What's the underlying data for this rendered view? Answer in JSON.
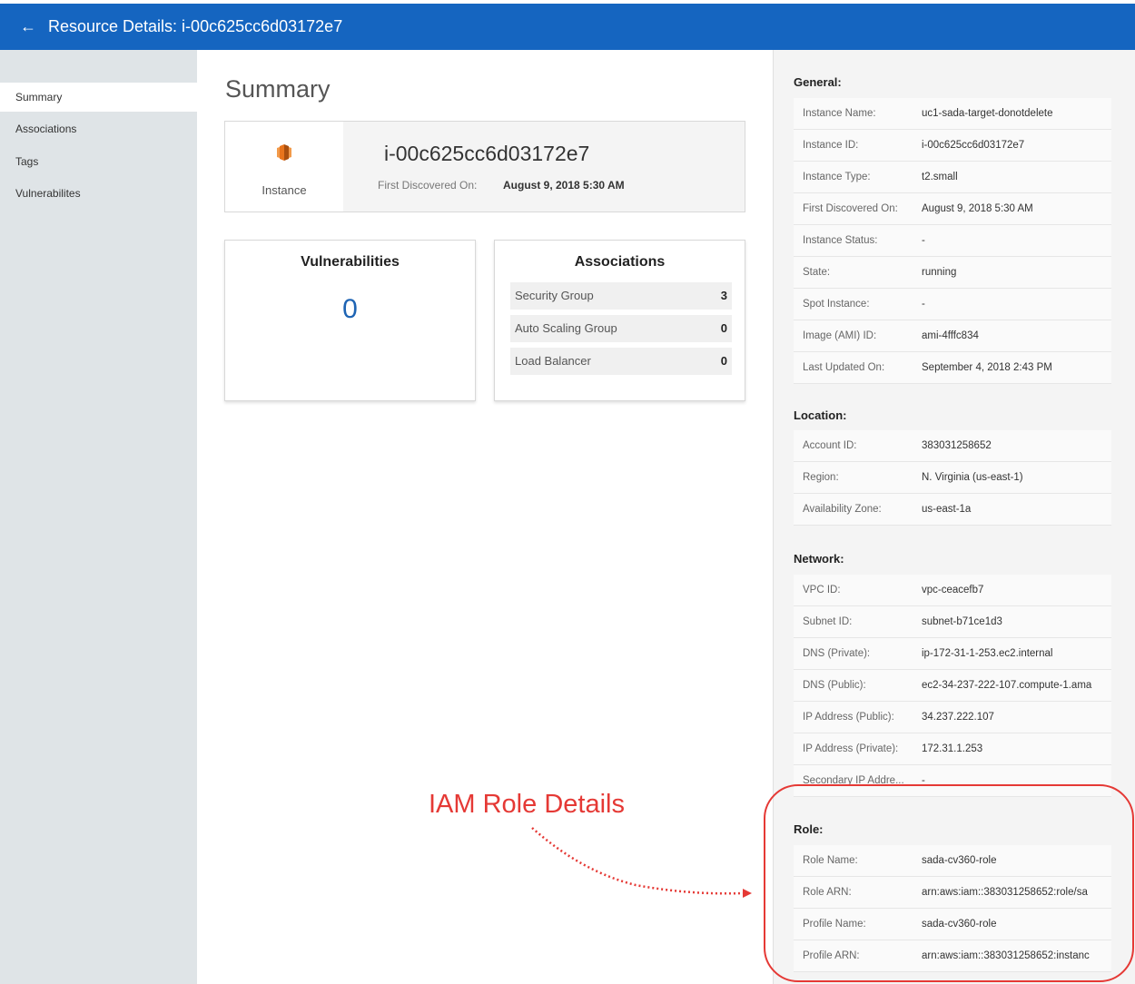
{
  "header": {
    "back_icon": "←",
    "title": "Resource Details: i-00c625cc6d03172e7"
  },
  "sidebar": {
    "items": [
      {
        "label": "Summary"
      },
      {
        "label": "Associations"
      },
      {
        "label": "Tags"
      },
      {
        "label": "Vulnerabilites"
      }
    ]
  },
  "main": {
    "title": "Summary",
    "summary": {
      "type_label": "Instance",
      "instance_id": "i-00c625cc6d03172e7",
      "first_discovered_label": "First Discovered On:",
      "first_discovered_value": "August 9, 2018 5:30 AM"
    },
    "vulnerabilities": {
      "title": "Vulnerabilities",
      "count": "0"
    },
    "associations": {
      "title": "Associations",
      "rows": [
        {
          "label": "Security Group",
          "value": "3"
        },
        {
          "label": "Auto Scaling Group",
          "value": "0"
        },
        {
          "label": "Load Balancer",
          "value": "0"
        }
      ]
    }
  },
  "annotation": {
    "text": "IAM Role Details",
    "color": "#e53935"
  },
  "details": {
    "general": {
      "title": "General:",
      "rows": [
        {
          "k": "Instance Name:",
          "v": "uc1-sada-target-donotdelete"
        },
        {
          "k": "Instance ID:",
          "v": "i-00c625cc6d03172e7"
        },
        {
          "k": "Instance Type:",
          "v": "t2.small"
        },
        {
          "k": "First Discovered On:",
          "v": "August 9, 2018 5:30 AM"
        },
        {
          "k": "Instance Status:",
          "v": "-"
        },
        {
          "k": "State:",
          "v": "running"
        },
        {
          "k": "Spot Instance:",
          "v": "-"
        },
        {
          "k": "Image (AMI) ID:",
          "v": "ami-4fffc834"
        },
        {
          "k": "Last Updated On:",
          "v": "September 4, 2018 2:43 PM"
        }
      ]
    },
    "location": {
      "title": "Location:",
      "rows": [
        {
          "k": "Account ID:",
          "v": "383031258652"
        },
        {
          "k": "Region:",
          "v": "N. Virginia (us-east-1)"
        },
        {
          "k": "Availability Zone:",
          "v": "us-east-1a"
        }
      ]
    },
    "network": {
      "title": "Network:",
      "rows": [
        {
          "k": "VPC ID:",
          "v": "vpc-ceacefb7"
        },
        {
          "k": "Subnet ID:",
          "v": "subnet-b71ce1d3"
        },
        {
          "k": "DNS (Private):",
          "v": "ip-172-31-1-253.ec2.internal"
        },
        {
          "k": "DNS (Public):",
          "v": "ec2-34-237-222-107.compute-1.ama"
        },
        {
          "k": "IP Address (Public):",
          "v": "34.237.222.107"
        },
        {
          "k": "IP Address (Private):",
          "v": "172.31.1.253"
        },
        {
          "k": "Secondary IP Addre...",
          "v": "-"
        }
      ]
    },
    "role": {
      "title": "Role:",
      "rows": [
        {
          "k": "Role Name:",
          "v": "sada-cv360-role"
        },
        {
          "k": "Role ARN:",
          "v": "arn:aws:iam::383031258652:role/sa"
        },
        {
          "k": "Profile Name:",
          "v": "sada-cv360-role"
        },
        {
          "k": "Profile ARN:",
          "v": "arn:aws:iam::383031258652:instanc"
        }
      ]
    }
  },
  "colors": {
    "header": "#1565c0",
    "accent_count": "#1e64b4",
    "annotation": "#e53935",
    "instance_icon": "#e8741c"
  }
}
